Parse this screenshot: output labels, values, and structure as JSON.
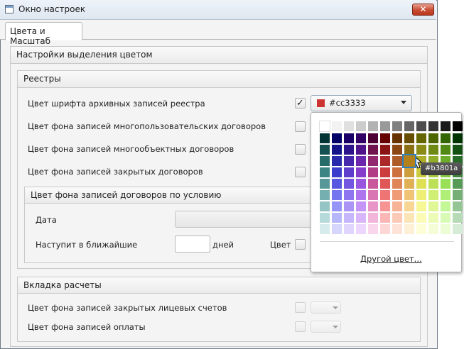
{
  "window": {
    "title": "Окно настроек",
    "close_glyph": "✕"
  },
  "tabs": [
    {
      "label": "Цвета и Масштаб",
      "selected": true
    }
  ],
  "highlight": {
    "title": "Настройки выделения цветом",
    "registries": {
      "title": "Реестры",
      "rows": [
        {
          "label": "Цвет шрифта архивных записей реестра",
          "checked": true
        },
        {
          "label": "Цвет фона записей многопользовательских договоров",
          "checked": false
        },
        {
          "label": "Цвет фона записей многообъектных договоров",
          "checked": false
        },
        {
          "label": "Цвет фона записей закрытых договоров",
          "checked": false
        }
      ],
      "color_picker": {
        "value": "#cc3333",
        "swatch_color": "#cc3333"
      },
      "conditional": {
        "title": "Цвет фона записей договоров по условию",
        "date_label": "Дата",
        "upcoming_label": "Наступит в ближайшие",
        "days_value": "",
        "days_suffix": "дней",
        "color_label": "Цвет"
      }
    },
    "calculations": {
      "title": "Вкладка расчеты",
      "rows": [
        {
          "label": "Цвет фона записей закрытых лицевых счетов",
          "checked": false
        },
        {
          "label": "Цвет фона записей оплаты",
          "checked": false
        }
      ]
    }
  },
  "palette_popup": {
    "top_row": [
      "#ffffff",
      "#f2f2f2",
      "#e0e0e0",
      "#cccccc",
      "#b3b3b3",
      "#999999",
      "#808080",
      "#666666",
      "#4d4d4d",
      "#333333",
      "#1a1a1a",
      "#000000"
    ],
    "grid": [
      [
        "#003333",
        "#000066",
        "#1a0066",
        "#330066",
        "#4d0033",
        "#660000",
        "#663300",
        "#664d00",
        "#666600",
        "#4d6600",
        "#336600",
        "#003300"
      ],
      [
        "#145050",
        "#14148a",
        "#2e148a",
        "#50148a",
        "#701450",
        "#8a1414",
        "#8a4714",
        "#8a6f14",
        "#8a8a14",
        "#6f8a14",
        "#508a14",
        "#145014"
      ],
      [
        "#286b6b",
        "#2828ad",
        "#4628ad",
        "#6b28ad",
        "#912870",
        "#ad2828",
        "#ad5c28",
        "#b3801a",
        "#adad28",
        "#8fad28",
        "#6bad28",
        "#286b28"
      ],
      [
        "#3d8585",
        "#3d3dcc",
        "#5e3dcc",
        "#853dcc",
        "#b03d85",
        "#cc3d3d",
        "#cc703d",
        "#cc9e3d",
        "#cccc3d",
        "#a8cc3d",
        "#85cc3d",
        "#3d853d"
      ],
      [
        "#579999",
        "#5757e0",
        "#7457e0",
        "#9957e0",
        "#c8579c",
        "#e05757",
        "#e08557",
        "#e0b057",
        "#e0e057",
        "#bce057",
        "#99e057",
        "#579957"
      ],
      [
        "#75afaf",
        "#7575ef",
        "#8f75ef",
        "#af75ef",
        "#da75b3",
        "#ef7575",
        "#ef9b75",
        "#efc575",
        "#efef75",
        "#d0ef75",
        "#afef75",
        "#75af75"
      ],
      [
        "#95c4c4",
        "#9595f7",
        "#aa95f7",
        "#c495f7",
        "#e895c8",
        "#f79595",
        "#f7b395",
        "#f7d695",
        "#f7f795",
        "#e0f795",
        "#c4f795",
        "#95c495"
      ],
      [
        "#b6d9d9",
        "#b6b6fb",
        "#c6b6fb",
        "#d9b6fb",
        "#f2b6db",
        "#fbb6b6",
        "#fbcab6",
        "#fbe4b6",
        "#fbfbb6",
        "#ecfbb6",
        "#d9fbb6",
        "#b6d9b6"
      ],
      [
        "#d6ecec",
        "#d6d6fd",
        "#e0d6fd",
        "#ecd6fd",
        "#f9d6ec",
        "#fdd6d6",
        "#fde2d6",
        "#fdf0d6",
        "#fdfdd6",
        "#f5fdd6",
        "#ecfdd6",
        "#d6ecd6"
      ]
    ],
    "selected_color": "#b3801a",
    "tooltip": "#b3801a",
    "other_color_label": "Другой цвет..."
  }
}
